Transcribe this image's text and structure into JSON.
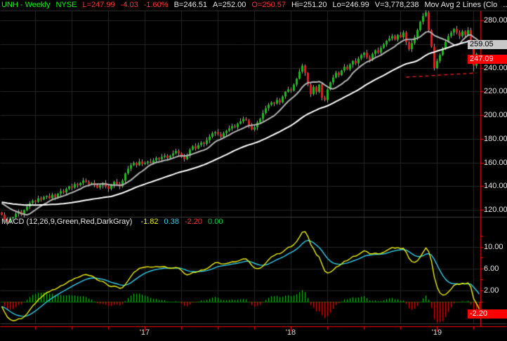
{
  "header": {
    "symbol": "UNH - Weekly",
    "exchange": "NYSE",
    "last": "L=247.99",
    "change": "-4.03",
    "change_pct": "-1.60%",
    "bid": "B=246.51",
    "ask": "A=252.00",
    "open": "O=250.57",
    "high": "Hi=251.20",
    "low": "Lo=246.99",
    "volume": "V=3,778,238",
    "indicator": "Mov Avg 2 Lines (Clo",
    "ellipsis": "..."
  },
  "macd_label": {
    "name": "MACD (12,26,9,Green,Red,DarkGray)",
    "macd_value": "-1.82",
    "signal_value": "0.38",
    "diff_value": "-2.20",
    "zero_value": "0.00"
  },
  "markers": {
    "ma": {
      "label": "259.05",
      "price": 259.05
    },
    "last": {
      "label": "247.09",
      "price": 247.09
    },
    "macd": {
      "label": "-2.20",
      "value": -2.2
    }
  },
  "price_axis": {
    "ticks": [
      {
        "value": 280,
        "label": "280.00"
      },
      {
        "value": 260,
        "label": "260.00"
      },
      {
        "value": 240,
        "label": "240.00"
      },
      {
        "value": 220,
        "label": "220.00"
      },
      {
        "value": 200,
        "label": "200.00"
      },
      {
        "value": 180,
        "label": "180.00"
      },
      {
        "value": 160,
        "label": "160.00"
      },
      {
        "value": 140,
        "label": "140.00"
      },
      {
        "value": 120,
        "label": "120.00"
      }
    ]
  },
  "macd_axis": {
    "ticks": [
      {
        "value": 10,
        "label": "10.00"
      },
      {
        "value": 6,
        "label": "6.00"
      },
      {
        "value": 2,
        "label": "2.00"
      }
    ],
    "minor_tick_values": [
      12,
      10,
      8,
      6,
      4,
      2,
      0,
      -2
    ]
  },
  "time_axis": {
    "years": [
      {
        "label": "'17",
        "week": 51
      },
      {
        "label": "'18",
        "week": 103
      },
      {
        "label": "'19",
        "week": 155
      }
    ],
    "quarter_weeks": [
      12,
      25,
      38,
      51,
      64,
      77,
      90,
      103,
      116,
      129,
      142,
      155,
      168
    ]
  },
  "chart_data": {
    "type": "candlestick+macd",
    "symbol": "UNH",
    "timeframe": "Weekly",
    "price_axis_range": [
      113,
      290
    ],
    "macd_axis_range": [
      -4.2,
      13.5
    ],
    "grid": true,
    "prehistory_close": 127,
    "first_open": 118,
    "weekly_closes": [
      116,
      112,
      110,
      113,
      114,
      117,
      119,
      116,
      120,
      123,
      126,
      128,
      127,
      130,
      129,
      131,
      132,
      130,
      133,
      131,
      134,
      136,
      135,
      138,
      140,
      139,
      142,
      141,
      143,
      145,
      144,
      142,
      143,
      141,
      139,
      141,
      143,
      140,
      138,
      141,
      144,
      142,
      140,
      145,
      151,
      155,
      158,
      160,
      158,
      161,
      159,
      160,
      161,
      160,
      162,
      164,
      163,
      165,
      166,
      164,
      166,
      168,
      170,
      168,
      165,
      163,
      166,
      171,
      174,
      172,
      175,
      177,
      176,
      179,
      182,
      185,
      186,
      184,
      182,
      185,
      187,
      189,
      191,
      190,
      193,
      195,
      197,
      196,
      191,
      188,
      190,
      194,
      197,
      202,
      206,
      209,
      211,
      210,
      213,
      211,
      216,
      220,
      222,
      221,
      226,
      231,
      237,
      242,
      236,
      226,
      218,
      224,
      220,
      226,
      215,
      213,
      222,
      228,
      232,
      236,
      234,
      238,
      241,
      239,
      243,
      246,
      244,
      248,
      251,
      253,
      249,
      247,
      252,
      255,
      253,
      257,
      260,
      263,
      265,
      267,
      264,
      268,
      266,
      270,
      262,
      256,
      261,
      266,
      272,
      279,
      284,
      287,
      272,
      258,
      240,
      246,
      251,
      257,
      262,
      267,
      270,
      273,
      270,
      267,
      271,
      268,
      272,
      261,
      242,
      252,
      247.99
    ],
    "last_bar": {
      "open": 250.57,
      "high": 251.2,
      "low": 246.99,
      "close": 247.99
    },
    "low_overrides": [
      {
        "week": 168,
        "low": 237.3
      }
    ],
    "indicators": {
      "ma_fast_period": 10,
      "ma_slow_period": 40,
      "macd_params": [
        12,
        26,
        9
      ]
    },
    "trendline": {
      "from_week": 144,
      "from_price": 232.3,
      "to_week": 169,
      "to_price": 235.9,
      "style": "dashed",
      "color": "#ff2020"
    }
  },
  "colors": {
    "background": "#000000",
    "grid": "#262626",
    "separator": "#3c3c3c",
    "axis": "#ff0000",
    "candle_up": "#00cf00",
    "candle_down": "#ff1212",
    "wick": "#ababab",
    "ma_fast": "#b4b4b4",
    "ma_slow": "#ffffff",
    "macd_line": "#f0f000",
    "signal_line": "#2fd0f0",
    "hist_pos": "#00c800",
    "hist_neg": "#ee0000",
    "zero_line": "#007000"
  }
}
